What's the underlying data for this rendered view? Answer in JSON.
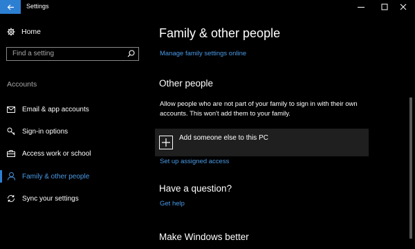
{
  "window": {
    "title": "Settings",
    "accent": "#2d7fd2",
    "link_color": "#4a9ae6"
  },
  "sidebar": {
    "home_label": "Home",
    "search_placeholder": "Find a setting",
    "section_label": "Accounts",
    "items": [
      {
        "label": "Email & app accounts",
        "icon": "mail-icon"
      },
      {
        "label": "Sign-in options",
        "icon": "key-icon"
      },
      {
        "label": "Access work or school",
        "icon": "briefcase-icon"
      },
      {
        "label": "Family & other people",
        "icon": "person-icon",
        "active": true
      },
      {
        "label": "Sync your settings",
        "icon": "sync-icon"
      }
    ]
  },
  "main": {
    "title": "Family & other people",
    "manage_family_link": "Manage family settings online",
    "other_people_heading": "Other people",
    "other_people_desc": "Allow people who are not part of your family to sign in with their own accounts. This won't add them to your family.",
    "add_someone_label": "Add someone else to this PC",
    "assigned_access_link": "Set up assigned access",
    "question_heading": "Have a question?",
    "get_help_link": "Get help",
    "make_better_heading": "Make Windows better"
  }
}
